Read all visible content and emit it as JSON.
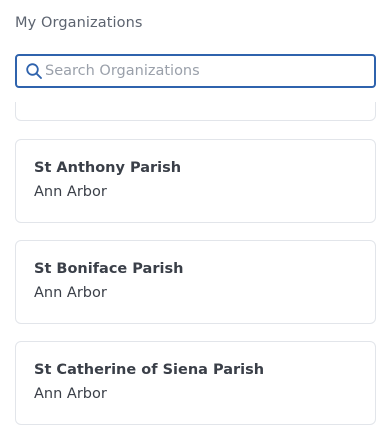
{
  "header": {
    "title": "My Organizations"
  },
  "search": {
    "placeholder": "Search Organizations",
    "value": ""
  },
  "organizations": [
    {
      "name": "St Anthony Parish",
      "city": "Ann Arbor"
    },
    {
      "name": "St Boniface Parish",
      "city": "Ann Arbor"
    },
    {
      "name": "St Catherine of Siena Parish",
      "city": "Ann Arbor"
    }
  ],
  "icons": {
    "search": "search-icon"
  },
  "colors": {
    "accent": "#2f63ad",
    "text": "#3a3f48",
    "muted": "#5d6470",
    "placeholder": "#9aa0aa",
    "card_border": "#e2e5ea"
  }
}
